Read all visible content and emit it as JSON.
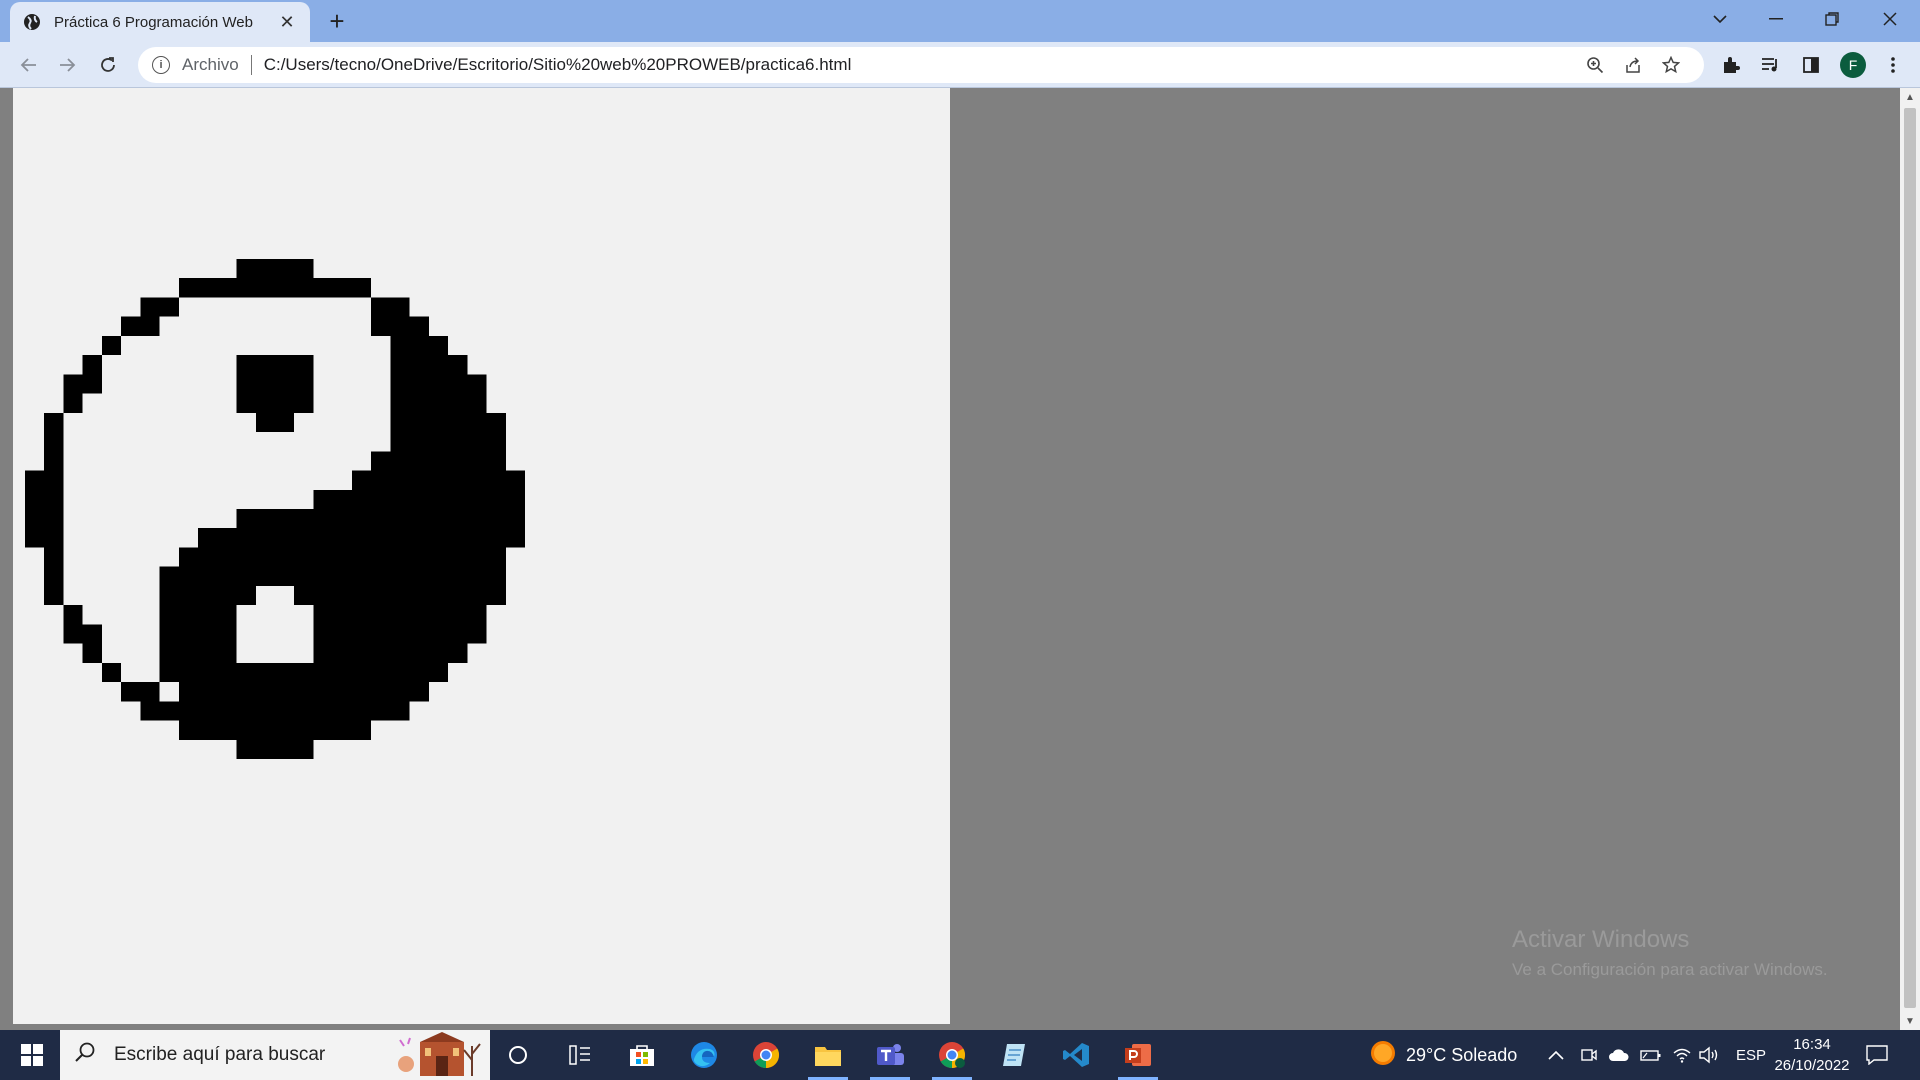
{
  "browser": {
    "tab_title": "Práctica 6 Programación Web",
    "tab_close": "✕",
    "new_tab": "+",
    "scheme_label": "Archivo",
    "url": "C:/Users/tecno/OneDrive/Escritorio/Sitio%20web%20PROWEB/practica6.html",
    "profile_initial": "F"
  },
  "page": {
    "background": "#f1f1f1",
    "yin_yang_grid_size": 26
  },
  "watermark": {
    "title": "Activar Windows",
    "subtitle": "Ve a Configuración para activar Windows."
  },
  "taskbar": {
    "search_placeholder": "Escribe aquí para buscar",
    "weather": "29°C  Soleado",
    "language": "ESP",
    "time": "16:34",
    "date": "26/10/2022"
  },
  "colors": {
    "tabstrip": "#8aaee6",
    "toolbar": "#dfe8f7",
    "taskbar": "#1f2b45"
  }
}
